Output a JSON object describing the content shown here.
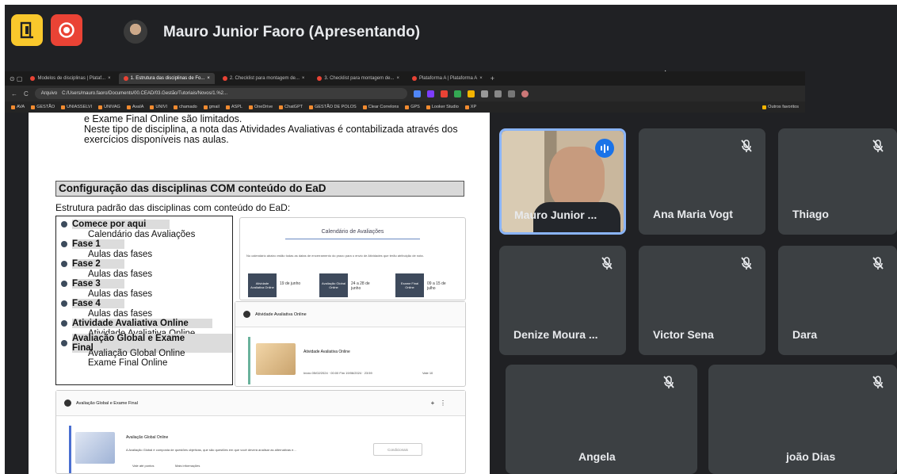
{
  "meet": {
    "presenter_title": "Mauro Junior Faoro (Apresentando)"
  },
  "browser": {
    "tabs": [
      {
        "label": "Modelos de disciplinas | Plataf...",
        "active": false
      },
      {
        "label": "1. Estrutura das disciplinas de Fo...",
        "active": true
      },
      {
        "label": "2. Checklist para montagem de...",
        "active": false
      },
      {
        "label": "3. Checklist para montagem de...",
        "active": false
      },
      {
        "label": "Plataforma A | Plataforma A",
        "active": false
      }
    ],
    "url_prefix": "Arquivo",
    "url": "C:/Users/mauro.faoro/Documents/00.CEAD/03.Gestão/Tutoriais/Novos/1.%2...",
    "bookmarks": [
      "AVA",
      "GESTÃO",
      "UNIASSELVI",
      "UNIVAG",
      "AvaIA",
      "UNIVI",
      "chamado",
      "gmail",
      "ASPL",
      "OneDrive",
      "ChatGPT",
      "GESTÃO DE POLOS",
      "Clear Correlons",
      "GPS",
      "Looker Studio",
      "XP"
    ],
    "bookmarks_folder": "Outros favoritos"
  },
  "document": {
    "intro_line1": "e Exame Final Online são limitados.",
    "intro_line2": "Neste tipo de disciplina, a nota das Atividades Avaliativas é contabilizada através dos",
    "intro_line3": "exercícios disponíveis nas aulas.",
    "section_heading": "Configuração das disciplinas COM conteúdo do EaD",
    "structure_label": "Estrutura padrão das disciplinas com conteúdo do EaD:",
    "outline": [
      {
        "title": "Comece por aqui",
        "sub": "Calendário das Avaliações"
      },
      {
        "title": "Fase 1",
        "sub": "Aulas das fases"
      },
      {
        "title": "Fase 2",
        "sub": "Aulas das fases"
      },
      {
        "title": "Fase 3",
        "sub": "Aulas das fases"
      },
      {
        "title": "Fase 4",
        "sub": "Aulas das fases"
      },
      {
        "title": "Atividade Avaliativa Online",
        "sub": "Atividade Avaliativa Online"
      },
      {
        "title": "Avaliação Global e Exame Final",
        "sub": "Avaliação Global Online",
        "sub2": "Exame Final Online"
      }
    ],
    "calendar": {
      "title": "Calendário de Avaliações",
      "description": "No calendário abaixo estão todas as datas de encerramento do prazo para o envio de Atividades que terão atribuição de nota.",
      "chips": [
        {
          "label": "Atividade Avaliativa Online",
          "value": "19 de junho"
        },
        {
          "label": "Avaliação Global Online",
          "value": "24 a 28 de junho"
        },
        {
          "label": "Exame Final Online",
          "value": "09 a 15 de julho"
        }
      ]
    },
    "activity_section": "Atividade Avaliativa Online",
    "activity_item": "Atividade Avaliativa Online",
    "activity_dates": "Início 05/02/2024 · 00:00   Fim 19/06/2024 · 23:59",
    "activity_grade": "Vale 10",
    "global_section": "Avaliação Global e Exame Final",
    "global_item": "Avaliação Global Online",
    "global_desc": "A Avaliação Global é composta de questões objetivas, que são questões em que você deverá analisar as alternativas e...",
    "global_status": "Condicionais",
    "global_points": "Vale até pontos",
    "global_view": "Mais informações"
  },
  "participants": [
    {
      "name": "Mauro Junior ...",
      "speaking": true
    },
    {
      "name": "Ana Maria Vogt",
      "muted": true
    },
    {
      "name": "Thiago",
      "muted": true
    },
    {
      "name": "Denize Moura ...",
      "muted": true
    },
    {
      "name": "Victor Sena",
      "muted": true
    },
    {
      "name": "Dara",
      "muted": true
    },
    {
      "name": "Angela",
      "muted": true
    },
    {
      "name": "joão Dias",
      "muted": true
    }
  ],
  "colors": {
    "meet_bg": "#202124",
    "tile_bg": "#3c4043",
    "speaker_border": "#8ab4f8",
    "leave_button": "#ea4335",
    "exit_button": "#f9c82c"
  }
}
